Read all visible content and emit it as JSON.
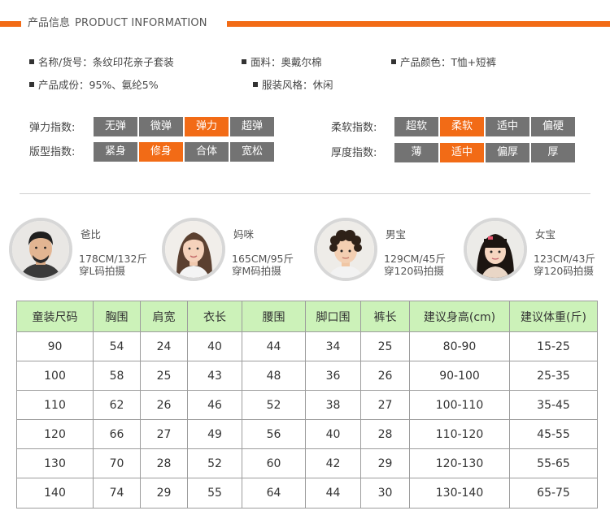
{
  "header": {
    "title_cn": "产品信息",
    "title_en": "PRODUCT INFORMATION",
    "accent_color": "#f26b16"
  },
  "info": {
    "name": "名称/货号：条纹印花亲子套装",
    "fabric": "面料：奥戴尔棉",
    "color": "产品颜色：T恤+短裤",
    "composition": "产品成份：95%、氨纶5%",
    "style": "服装风格：休闲"
  },
  "indices": {
    "elasticity": {
      "label": "弹力指数:",
      "options": [
        "无弹",
        "微弹",
        "弹力",
        "超弹"
      ],
      "selected": "弹力"
    },
    "softness": {
      "label": "柔软指数:",
      "options": [
        "超软",
        "柔软",
        "适中",
        "偏硬"
      ],
      "selected": "柔软"
    },
    "fit": {
      "label": "版型指数:",
      "options": [
        "紧身",
        "修身",
        "合体",
        "宽松"
      ],
      "selected": "修身"
    },
    "thickness": {
      "label": "厚度指数:",
      "options": [
        "薄",
        "适中",
        "偏厚",
        "厚"
      ],
      "selected": "适中"
    }
  },
  "models": [
    {
      "name": "爸比",
      "size": "178CM/132斤",
      "wear": "穿L码拍摄",
      "icon": "man-portrait-icon"
    },
    {
      "name": "妈咪",
      "size": "165CM/95斤",
      "wear": "穿M码拍摄",
      "icon": "woman-portrait-icon"
    },
    {
      "name": "男宝",
      "size": "129CM/45斤",
      "wear": "穿120码拍摄",
      "icon": "boy-portrait-icon"
    },
    {
      "name": "女宝",
      "size": "123CM/43斤",
      "wear": "穿120码拍摄",
      "icon": "girl-portrait-icon"
    }
  ],
  "size_table": {
    "header_color": "#ccf2b9",
    "headers": [
      "童装尺码",
      "胸围",
      "肩宽",
      "衣长",
      "腰围",
      "脚口围",
      "裤长",
      "建议身高(cm)",
      "建议体重(斤)"
    ],
    "rows": [
      [
        "90",
        "54",
        "24",
        "40",
        "44",
        "34",
        "25",
        "80-90",
        "15-25"
      ],
      [
        "100",
        "58",
        "25",
        "43",
        "48",
        "36",
        "26",
        "90-100",
        "25-35"
      ],
      [
        "110",
        "62",
        "26",
        "46",
        "52",
        "38",
        "27",
        "100-110",
        "35-45"
      ],
      [
        "120",
        "66",
        "27",
        "49",
        "56",
        "40",
        "28",
        "110-120",
        "45-55"
      ],
      [
        "130",
        "70",
        "28",
        "52",
        "60",
        "42",
        "29",
        "120-130",
        "55-65"
      ],
      [
        "140",
        "74",
        "29",
        "55",
        "64",
        "44",
        "30",
        "130-140",
        "65-75"
      ]
    ]
  }
}
